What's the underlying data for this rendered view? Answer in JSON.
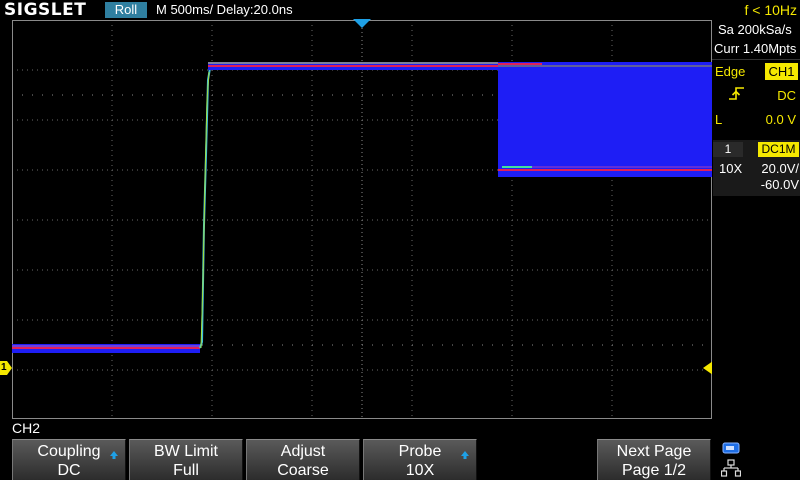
{
  "topbar": {
    "logo": "SIGSLET",
    "mode": "Roll",
    "timebase": "M 500ms/  Delay:20.0ns",
    "trigger_freq": "f < 10Hz"
  },
  "right_panel": {
    "sample_rate": "Sa 200kSa/s",
    "memory_depth": "Curr 1.40Mpts",
    "trigger_type_label": "Edge",
    "trigger_source": "CH1",
    "trigger_slope_icon": "rising-edge-icon",
    "trigger_coupling": "DC",
    "trigger_level_label": "L",
    "trigger_level_value": "0.0 V",
    "channel_num": "1",
    "channel_coupling": "DC1M",
    "probe": "10X",
    "volts_div": "20.0V/",
    "offset": "-60.0V"
  },
  "channel_label": "CH2",
  "softkeys": [
    {
      "line1": "Coupling",
      "line2": "DC",
      "has_arrow": true
    },
    {
      "line1": "BW Limit",
      "line2": "Full",
      "has_arrow": false
    },
    {
      "line1": "Adjust",
      "line2": "Coarse",
      "has_arrow": false
    },
    {
      "line1": "Probe",
      "line2": "10X",
      "has_arrow": true
    },
    {
      "line1": "Next Page",
      "line2": "Page 1/2",
      "has_arrow": false
    }
  ],
  "icons": {
    "usb": "usb-icon",
    "network": "network-icon",
    "trigger_position": "trigger-position-marker-icon",
    "channel_marker": "channel-1-ground-marker-icon"
  },
  "colors": {
    "channel1": "#f5e800",
    "trace": "#1e1ef5",
    "roll_badge": "#2f7fa0",
    "grid": "#6a6a6a",
    "trigger_marker": "#1ea0e6"
  },
  "marker_text": {
    "channel_marker": "1"
  }
}
